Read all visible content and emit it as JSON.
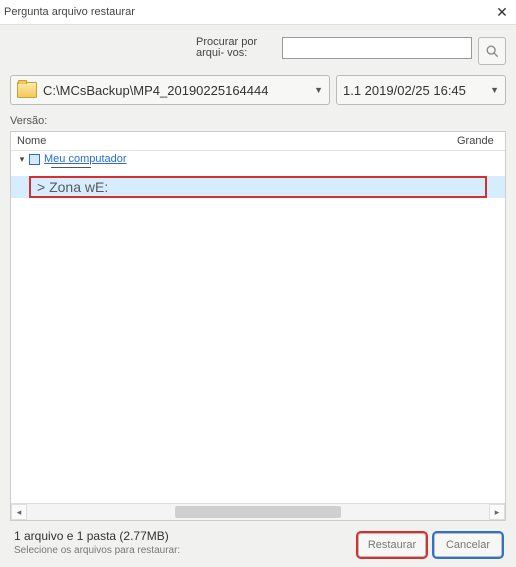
{
  "title": "Pergunta arquivo restaurar",
  "search": {
    "label": "Procurar por arqui-\nvos:",
    "value": ""
  },
  "path": {
    "value": "C:\\MCsBackup\\MP4_20190225164444"
  },
  "version": {
    "label": "Versão:",
    "value": "1.1  2019/02/25 16:45"
  },
  "tree": {
    "headers": {
      "name": "Nome",
      "size": "Grande"
    },
    "root": "Meu computador",
    "selected": "> Zona wE:"
  },
  "footer": {
    "summary": "1 arquivo e 1 pasta (2.77MB)",
    "hint": "Selecione os arquivos para\nrestaurar:",
    "restore": "Restaurar",
    "cancel": "Cancelar"
  }
}
